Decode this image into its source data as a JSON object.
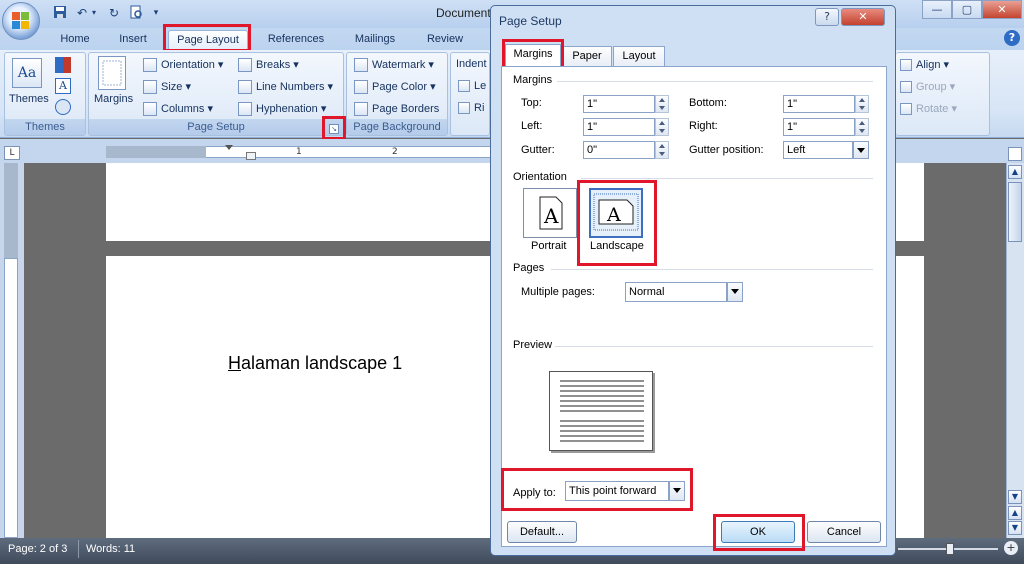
{
  "window": {
    "title": "Document",
    "min": "—",
    "max": "▢",
    "close": "✕",
    "help": "?"
  },
  "qat": [
    "save-icon",
    "undo-icon",
    "redo-icon",
    "print-preview-icon"
  ],
  "tabs": [
    "Home",
    "Insert",
    "Page Layout",
    "References",
    "Mailings",
    "Review"
  ],
  "ribbon": {
    "themes": {
      "big": "Themes",
      "group": "Themes"
    },
    "page_setup": {
      "margins": "Margins",
      "orientation": "Orientation",
      "size": "Size",
      "columns": "Columns",
      "breaks": "Breaks",
      "line_numbers": "Line Numbers",
      "hyphenation": "Hyphenation",
      "group": "Page Setup"
    },
    "page_background": {
      "watermark": "Watermark",
      "page_color": "Page Color",
      "page_borders": "Page Borders",
      "group": "Page Background"
    },
    "paragraph_partial": {
      "indent": "Indent",
      "left": "Le",
      "right": "Ri"
    },
    "arrange": {
      "align": "Align",
      "group": "Group",
      "rotate": "Rotate"
    }
  },
  "ruler": {
    "ticks": [
      "1",
      "2"
    ]
  },
  "document": {
    "text_H": "H",
    "text_rest": "alaman landscape 1"
  },
  "status": {
    "page": "Page: 2 of 3",
    "words": "Words: 11"
  },
  "dialog": {
    "title": "Page Setup",
    "tabs": [
      "Margins",
      "Paper",
      "Layout"
    ],
    "margins_section": "Margins",
    "top_label": "Top:",
    "top_value": "1\"",
    "bottom_label": "Bottom:",
    "bottom_value": "1\"",
    "left_label": "Left:",
    "left_value": "1\"",
    "right_label": "Right:",
    "right_value": "1\"",
    "gutter_label": "Gutter:",
    "gutter_value": "0\"",
    "gutter_pos_label": "Gutter position:",
    "gutter_pos_value": "Left",
    "orientation_section": "Orientation",
    "portrait": "Portrait",
    "landscape": "Landscape",
    "orientation_selected": "Landscape",
    "pages_section": "Pages",
    "multiple_pages_label": "Multiple pages:",
    "multiple_pages_value": "Normal",
    "preview_section": "Preview",
    "apply_to_label": "Apply to:",
    "apply_to_value": "This point forward",
    "default_btn": "Default...",
    "ok_btn": "OK",
    "cancel_btn": "Cancel"
  },
  "colors": {
    "highlight": "#e0162b",
    "ribbon": "#dce8f7",
    "dialog_bg": "#cfe0f5"
  }
}
